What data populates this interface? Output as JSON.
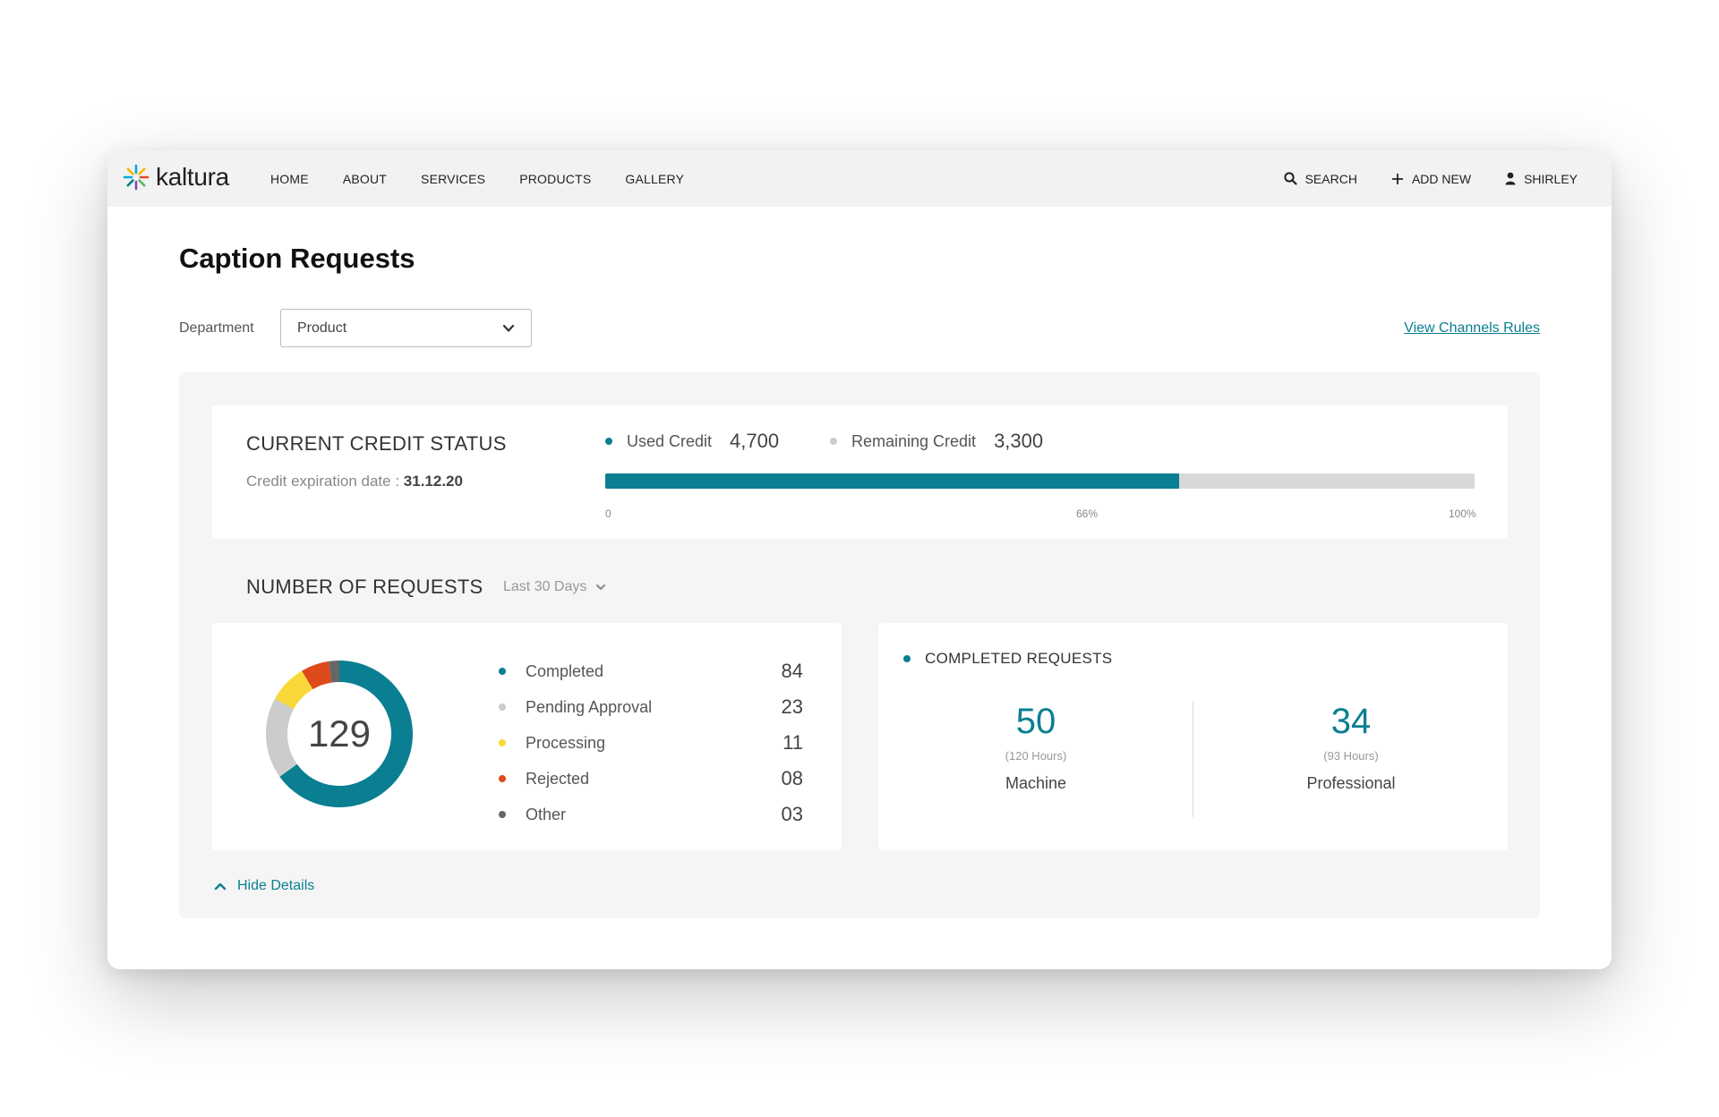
{
  "brand": {
    "name": "kaltura",
    "logo_colors": [
      "#00a9e0",
      "#f7b500",
      "#e8472f",
      "#5cb85c",
      "#7d4bb5",
      "#0a7f91"
    ]
  },
  "nav": {
    "links": [
      "HOME",
      "ABOUT",
      "SERVICES",
      "PRODUCTS",
      "GALLERY"
    ],
    "search_label": "SEARCH",
    "add_new_label": "ADD NEW",
    "user_label": "SHIRLEY"
  },
  "page": {
    "title": "Caption Requests",
    "department_label": "Department",
    "department_value": "Product",
    "channels_link": "View Channels Rules"
  },
  "credit": {
    "title": "CURRENT CREDIT STATUS",
    "expiration_label": "Credit expiration date :",
    "expiration_date": "31.12.20",
    "used_label": "Used Credit",
    "used_value": "4,700",
    "remaining_label": "Remaining Credit",
    "remaining_value": "3,300",
    "used_fraction": 0.66,
    "ticks": [
      "0",
      "66%",
      "100%"
    ]
  },
  "requests": {
    "title": "NUMBER OF REQUESTS",
    "period": "Last 30 Days",
    "total": "129",
    "statuses": [
      {
        "label": "Completed",
        "count": "84",
        "value": 84,
        "color": "#0a7f91"
      },
      {
        "label": "Pending Approval",
        "count": "23",
        "value": 23,
        "color": "#cccccc"
      },
      {
        "label": "Processing",
        "count": "11",
        "value": 11,
        "color": "#f9d93a"
      },
      {
        "label": "Rejected",
        "count": "08",
        "value": 8,
        "color": "#dd4a1c"
      },
      {
        "label": "Other",
        "count": "03",
        "value": 3,
        "color": "#666666"
      }
    ]
  },
  "completed": {
    "title": "COMPLETED REQUESTS",
    "machine": {
      "value": "50",
      "hours": "(120 Hours)",
      "label": "Machine"
    },
    "professional": {
      "value": "34",
      "hours": "(93 Hours)",
      "label": "Professional"
    }
  },
  "hide_details_label": "Hide Details"
}
